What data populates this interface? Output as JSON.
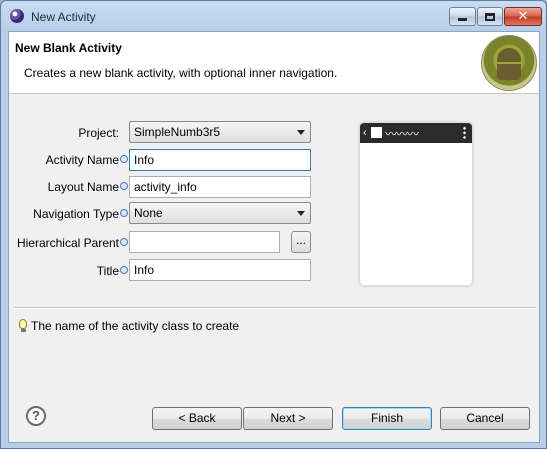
{
  "window": {
    "title": "New Activity"
  },
  "header": {
    "title": "New Blank Activity",
    "description": "Creates a new blank activity, with optional inner navigation."
  },
  "form": {
    "project": {
      "label": "Project:",
      "value": "SimpleNumb3r5"
    },
    "activity_name": {
      "label": "Activity Name",
      "value": "Info"
    },
    "layout_name": {
      "label": "Layout Name",
      "value": "activity_info"
    },
    "navigation_type": {
      "label": "Navigation Type",
      "value": "None"
    },
    "hierarchical_parent": {
      "label": "Hierarchical Parent",
      "value": "",
      "browse_label": "..."
    },
    "title": {
      "label": "Title",
      "value": "Info"
    }
  },
  "preview": {
    "title_squiggle": "〰〰〰"
  },
  "status": {
    "message": "The name of the activity class to create"
  },
  "buttons": {
    "help": "?",
    "back": "< Back",
    "next": "Next >",
    "finish": "Finish",
    "cancel": "Cancel"
  },
  "icons": {
    "app": "eclipse-icon",
    "minimize": "minimize-icon",
    "maximize": "maximize-icon",
    "close": "close-icon",
    "logo": "android-logo",
    "info": "info-icon",
    "bulb": "lightbulb-icon"
  }
}
